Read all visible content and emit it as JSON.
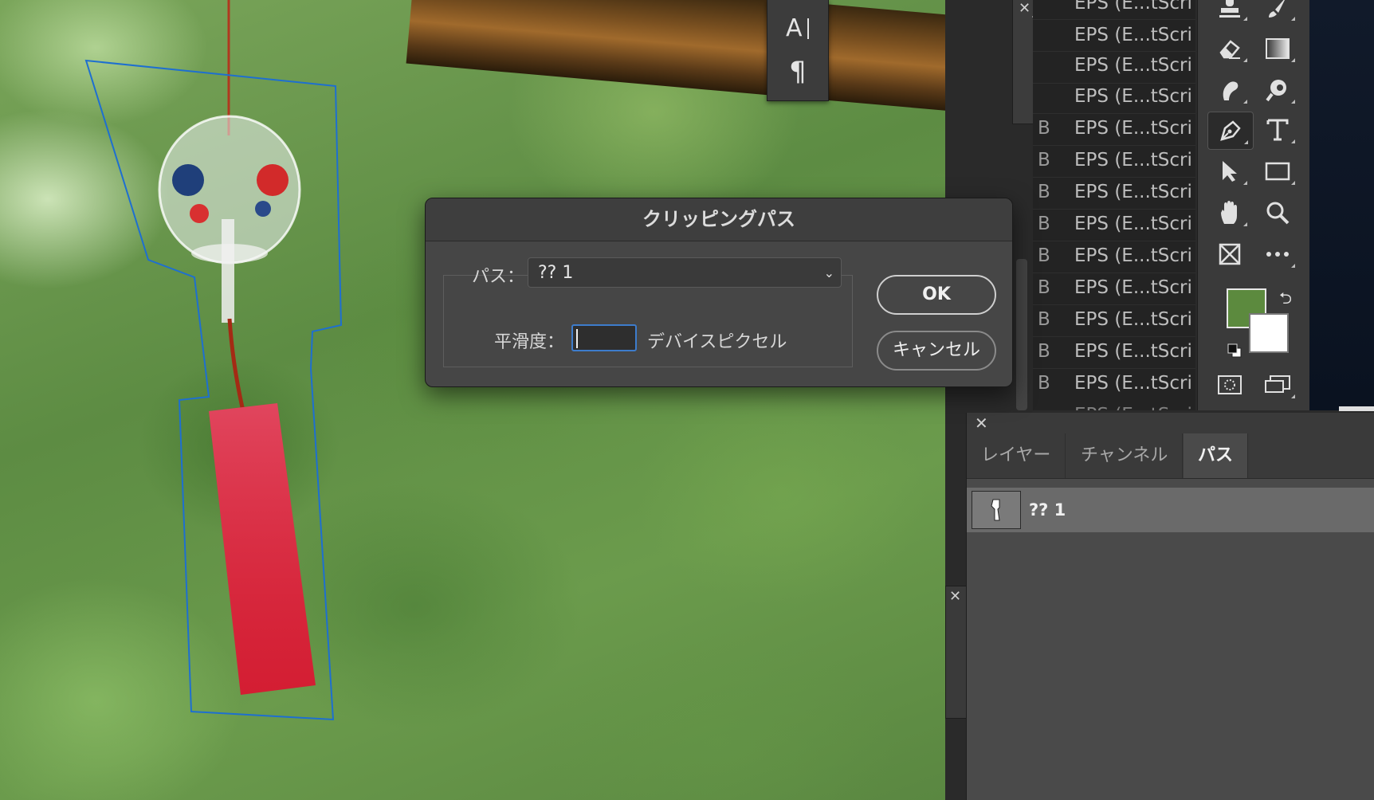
{
  "canvas": {
    "description_icon": "wind-chime-photo"
  },
  "character_panel": {
    "buttons": [
      "character-icon",
      "paragraph-icon"
    ]
  },
  "actions_panel": {
    "buttons": [
      "toggle-dialog-icon",
      "play-icon"
    ]
  },
  "format_list": {
    "items": [
      {
        "prefix": "",
        "label": "EPS (E...tScri"
      },
      {
        "prefix": "",
        "label": "EPS (E...tScri"
      },
      {
        "prefix": "",
        "label": "EPS (E...tScri"
      },
      {
        "prefix": "",
        "label": "EPS (E...tScri"
      },
      {
        "prefix": "B",
        "label": "EPS (E...tScri"
      },
      {
        "prefix": "B",
        "label": "EPS (E...tScri"
      },
      {
        "prefix": "B",
        "label": "EPS (E...tScri"
      },
      {
        "prefix": "B",
        "label": "EPS (E...tScri"
      },
      {
        "prefix": "B",
        "label": "EPS (E...tScri"
      },
      {
        "prefix": "B",
        "label": "EPS (E...tScri"
      },
      {
        "prefix": "B",
        "label": "EPS (E...tScri"
      },
      {
        "prefix": "B",
        "label": "EPS (E...tScri"
      },
      {
        "prefix": "B",
        "label": "EPS (E...tScri"
      }
    ]
  },
  "toolbar": {
    "tools": [
      "stamp-icon",
      "brush-icon",
      "eraser-icon",
      "gradient-icon",
      "smudge-icon",
      "dodge-icon",
      "pen-icon",
      "type-icon",
      "path-select-icon",
      "rectangle-icon",
      "hand-icon",
      "zoom-icon",
      "frame-icon",
      "more-icon",
      "quick-mask-icon",
      "screen-mode-icon"
    ],
    "foreground_color": "#5c8a3e",
    "background_color": "#ffffff"
  },
  "dialog": {
    "title": "クリッピングパス",
    "path_label": "パス：",
    "path_value": "?? 1",
    "flatness_label": "平滑度：",
    "flatness_value": "",
    "unit_label": "デバイスピクセル",
    "ok_label": "OK",
    "cancel_label": "キャンセル"
  },
  "paths_panel": {
    "tabs": [
      {
        "label": "レイヤー",
        "active": false
      },
      {
        "label": "チャンネル",
        "active": false
      },
      {
        "label": "パス",
        "active": true
      }
    ],
    "paths": [
      {
        "name": "?? 1"
      }
    ]
  },
  "colors": {
    "accent": "#3d7ccc",
    "path_outline": "#1e6fd0"
  }
}
